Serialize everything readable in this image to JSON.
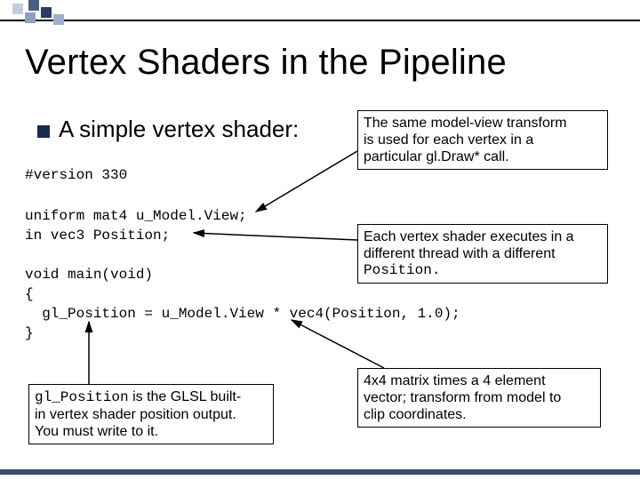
{
  "title": "Vertex Shaders in the Pipeline",
  "bullet": {
    "prefix": "A simple ",
    "emph": "vertex shader",
    "suffix": ":"
  },
  "code": {
    "l1": "#version 330",
    "l2": "uniform mat4 u_Model.View;",
    "l3": "in vec3 Position;",
    "l4": "void main(void)",
    "l5": "{",
    "l6": "  gl_Position = u_Model.View * vec4(Position, 1.0);",
    "l7": "}"
  },
  "callouts": {
    "top": {
      "l1": "The same model-view transform",
      "l2": "is used for each vertex in a",
      "l3_a": "particular ",
      "l3_b": "gl.Draw*",
      "l3_c": " call."
    },
    "mid": {
      "l1": "Each vertex shader executes in a",
      "l2": "different thread with a different",
      "l3": "Position."
    },
    "botL": {
      "l1_a": "gl_Position",
      "l1_b": " is the GLSL built-",
      "l2": "in vertex shader position output.",
      "l3": "You must write to it."
    },
    "botR": {
      "l1": "4x4 matrix times a 4 element",
      "l2": "vector; transform from model to",
      "l3": "clip coordinates."
    }
  }
}
